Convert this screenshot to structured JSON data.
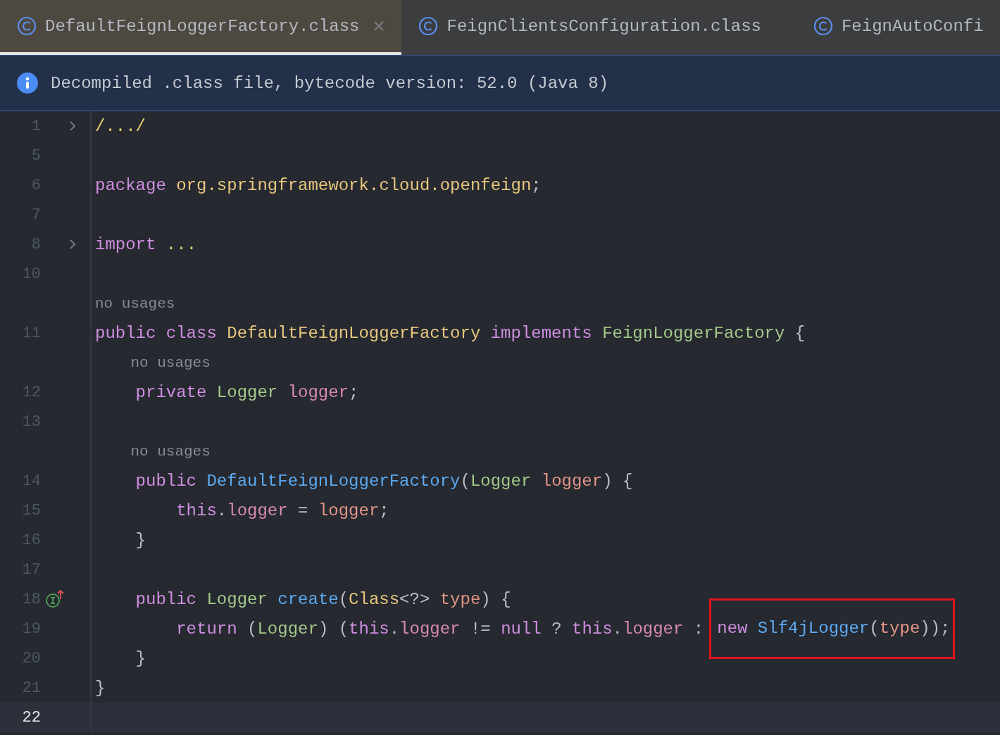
{
  "tabs": [
    {
      "label": "DefaultFeignLoggerFactory.class",
      "selected": true,
      "closable": true
    },
    {
      "label": "FeignClientsConfiguration.class",
      "selected": false,
      "closable": false
    },
    {
      "label": "FeignAutoConfi",
      "selected": false,
      "closable": false
    }
  ],
  "banner": {
    "text": "Decompiled .class file, bytecode version: 52.0 (Java 8)"
  },
  "lines": [
    {
      "number": "1",
      "foldable": true,
      "tokens": [
        {
          "kind": "folded",
          "text": "/.../"
        }
      ]
    },
    {
      "number": "5"
    },
    {
      "number": "6",
      "tokens": [
        {
          "kind": "keyword",
          "text": "package "
        },
        {
          "kind": "package",
          "text": "org.springframework.cloud.openfeign"
        },
        {
          "kind": "plain",
          "text": ";"
        }
      ]
    },
    {
      "number": "7"
    },
    {
      "number": "8",
      "foldable": true,
      "tokens": [
        {
          "kind": "keyword",
          "text": "import "
        },
        {
          "kind": "folded",
          "text": "..."
        }
      ]
    },
    {
      "number": "10"
    },
    {
      "number": "11",
      "hint": "no usages",
      "tokens": [
        {
          "kind": "keyword",
          "text": "public class "
        },
        {
          "kind": "classname",
          "text": "DefaultFeignLoggerFactory "
        },
        {
          "kind": "keyword",
          "text": "implements "
        },
        {
          "kind": "type",
          "text": "FeignLoggerFactory "
        },
        {
          "kind": "plain",
          "text": "{"
        }
      ]
    },
    {
      "number": "12",
      "hint": "no usages",
      "tokens": [
        {
          "kind": "keyword",
          "text": "    private "
        },
        {
          "kind": "type",
          "text": "Logger "
        },
        {
          "kind": "field",
          "text": "logger"
        },
        {
          "kind": "plain",
          "text": ";"
        }
      ]
    },
    {
      "number": "13"
    },
    {
      "number": "14",
      "hint": "no usages",
      "tokens": [
        {
          "kind": "keyword",
          "text": "    public "
        },
        {
          "kind": "method",
          "text": "DefaultFeignLoggerFactory"
        },
        {
          "kind": "plain",
          "text": "("
        },
        {
          "kind": "type",
          "text": "Logger "
        },
        {
          "kind": "param",
          "text": "logger"
        },
        {
          "kind": "plain",
          "text": ") {"
        }
      ]
    },
    {
      "number": "15",
      "tokens": [
        {
          "kind": "keyword",
          "text": "        this"
        },
        {
          "kind": "plain",
          "text": "."
        },
        {
          "kind": "field",
          "text": "logger "
        },
        {
          "kind": "plain",
          "text": "= "
        },
        {
          "kind": "param",
          "text": "logger"
        },
        {
          "kind": "plain",
          "text": ";"
        }
      ]
    },
    {
      "number": "16",
      "tokens": [
        {
          "kind": "plain",
          "text": "    }"
        }
      ]
    },
    {
      "number": "17"
    },
    {
      "number": "18",
      "implements_marker": true,
      "tokens": [
        {
          "kind": "keyword",
          "text": "    public "
        },
        {
          "kind": "type",
          "text": "Logger "
        },
        {
          "kind": "method",
          "text": "create"
        },
        {
          "kind": "plain",
          "text": "("
        },
        {
          "kind": "classname",
          "text": "Class"
        },
        {
          "kind": "plain",
          "text": "<?> "
        },
        {
          "kind": "param",
          "text": "type"
        },
        {
          "kind": "plain",
          "text": ") {"
        }
      ]
    },
    {
      "number": "19",
      "tokens": [
        {
          "kind": "keyword",
          "text": "        return "
        },
        {
          "kind": "plain",
          "text": "("
        },
        {
          "kind": "type",
          "text": "Logger"
        },
        {
          "kind": "plain",
          "text": ") ("
        },
        {
          "kind": "keyword",
          "text": "this"
        },
        {
          "kind": "plain",
          "text": "."
        },
        {
          "kind": "field",
          "text": "logger "
        },
        {
          "kind": "plain",
          "text": "!= "
        },
        {
          "kind": "keyword",
          "text": "null "
        },
        {
          "kind": "plain",
          "text": "? "
        },
        {
          "kind": "keyword",
          "text": "this"
        },
        {
          "kind": "plain",
          "text": "."
        },
        {
          "kind": "field",
          "text": "logger "
        },
        {
          "kind": "plain",
          "text": ":"
        },
        {
          "kind": "highlight",
          "tokens": [
            {
              "kind": "keyword",
              "text": "new "
            },
            {
              "kind": "method",
              "text": "Slf4jLogger"
            },
            {
              "kind": "plain",
              "text": "("
            },
            {
              "kind": "param",
              "text": "type"
            },
            {
              "kind": "plain",
              "text": "));"
            }
          ]
        }
      ]
    },
    {
      "number": "20",
      "tokens": [
        {
          "kind": "plain",
          "text": "    }"
        }
      ]
    },
    {
      "number": "21",
      "tokens": [
        {
          "kind": "plain",
          "text": "}"
        }
      ]
    },
    {
      "number": "22",
      "current": true
    }
  ]
}
